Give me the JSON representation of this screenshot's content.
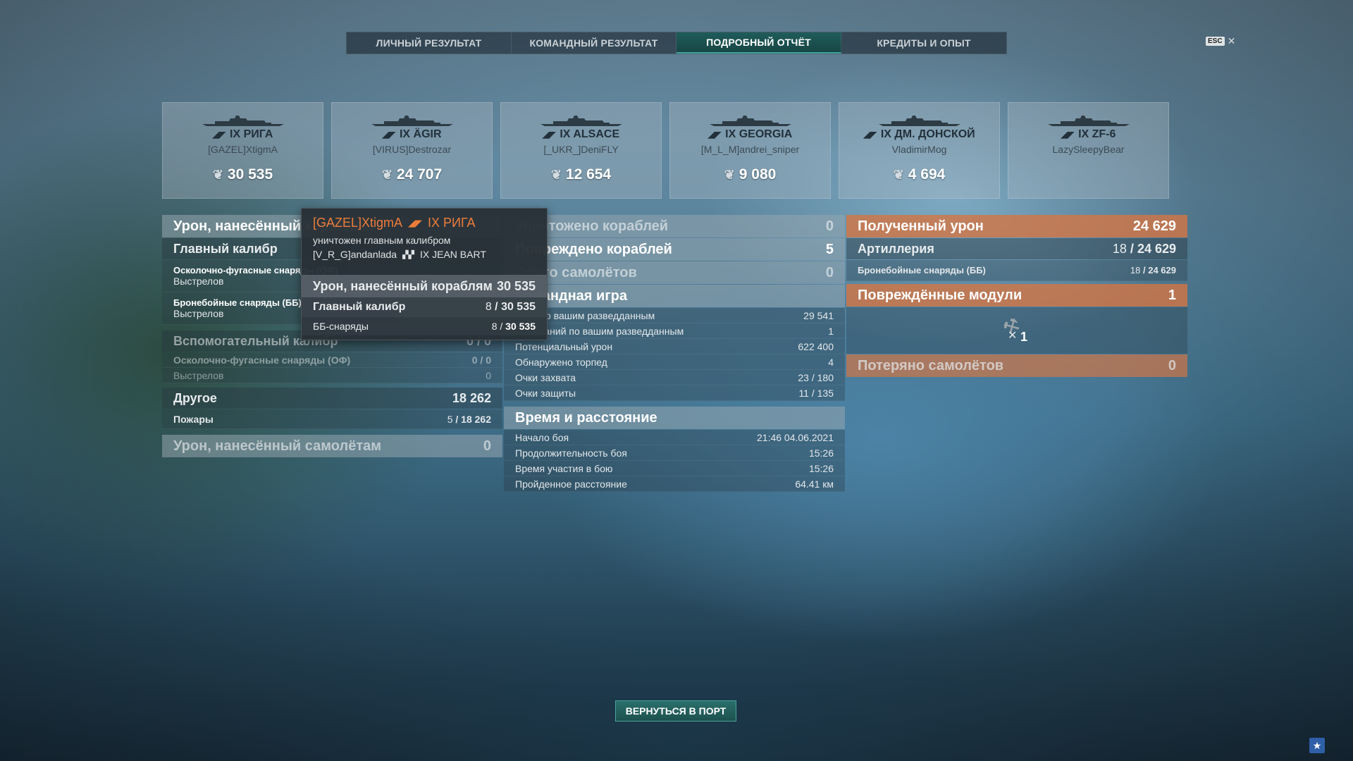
{
  "tabs": [
    {
      "label": "ЛИЧНЫЙ РЕЗУЛЬТАТ",
      "active": false
    },
    {
      "label": "КОМАНДНЫЙ РЕЗУЛЬТАТ",
      "active": false
    },
    {
      "label": "ПОДРОБНЫЙ ОТЧЁТ",
      "active": true
    },
    {
      "label": "КРЕДИТЫ И ОПЫТ",
      "active": false
    }
  ],
  "esc": {
    "key": "ESC",
    "close": "✕"
  },
  "ships": [
    {
      "name": "IX РИГА",
      "player": "[GAZEL]XtigmA",
      "damage": "30 535"
    },
    {
      "name": "IX ÄGIR",
      "player": "[VIRUS]Destrozar",
      "damage": "24 707"
    },
    {
      "name": "IX ALSACE",
      "player": "[_UKR_]DeniFLY",
      "damage": "12 654"
    },
    {
      "name": "IX GEORGIA",
      "player": "[M_L_M]andrei_sniper",
      "damage": "9 080"
    },
    {
      "name": "IX ДМ. ДОНСКОЙ",
      "player": "VladimirMog",
      "damage": "4 694"
    },
    {
      "name": "IX ZF-6",
      "player": "LazySleepyBear",
      "damage": ""
    }
  ],
  "left": {
    "damage_header": "Урон, нанесённый кораблям",
    "main_battery": {
      "label": "Главный калибр"
    },
    "he": {
      "label": "Осколочно-фугасные снаряды (ОФ)",
      "shots_label": "Выстрелов"
    },
    "ap": {
      "label": "Бронебойные снаряды (ББ)",
      "shots_label": "Выстрелов"
    },
    "secondary": {
      "label": "Вспомогательный калибр",
      "value": "0 / 0"
    },
    "secondary_he": {
      "label": "Осколочно-фугасные снаряды (ОФ)",
      "value": "0 / 0"
    },
    "secondary_shots": {
      "label": "Выстрелов",
      "value": "0"
    },
    "other": {
      "label": "Другое",
      "value": "18 262"
    },
    "fires": {
      "label": "Пожары",
      "hits": "5",
      "dmg": "18 262"
    },
    "aircraft_damage": {
      "label": "Урон, нанесённый самолётам",
      "value": "0"
    }
  },
  "mid": {
    "destroyed": {
      "label": "Уничтожено кораблей",
      "value": "0"
    },
    "damaged": {
      "label": "Повреждено кораблей",
      "value": "5"
    },
    "planes": {
      "label": "Сбито самолётов",
      "value": "0"
    },
    "team_header": "Командная игра",
    "team": [
      {
        "label": "Урон по вашим разведданным",
        "value": "29 541"
      },
      {
        "label": "Попаданий по вашим разведданным",
        "value": "1"
      },
      {
        "label": "Потенциальный урон",
        "value": "622 400"
      },
      {
        "label": "Обнаружено торпед",
        "value": "4"
      },
      {
        "label": "Очки захвата",
        "value": "23 / 180"
      },
      {
        "label": "Очки защиты",
        "value": "11 / 135"
      }
    ],
    "time_header": "Время и расстояние",
    "time": [
      {
        "label": "Начало боя",
        "value": "21:46  04.06.2021"
      },
      {
        "label": "Продолжительность боя",
        "value": "15:26"
      },
      {
        "label": "Время участия в бою",
        "value": "15:26"
      },
      {
        "label": "Пройденное расстояние",
        "value": "64.41 км"
      }
    ]
  },
  "right": {
    "received": {
      "label": "Полученный урон",
      "value": "24 629"
    },
    "artillery": {
      "label": "Артиллерия",
      "hits": "18",
      "dmg": "24 629"
    },
    "ap": {
      "label": "Бронебойные снаряды (ББ)",
      "hits": "18",
      "dmg": "24 629"
    },
    "modules": {
      "label": "Повреждённые модули",
      "value": "1",
      "icon_count": "1"
    },
    "planes_lost": {
      "label": "Потеряно самолётов",
      "value": "0"
    }
  },
  "tooltip": {
    "player": "[GAZEL]XtigmA",
    "ship": "IX РИГА",
    "destroyed_by": "уничтожен главным калибром",
    "killer_player": "[V_R_G]andanlada",
    "killer_ship": "IX JEAN BART",
    "dmg_label": "Урон, нанесённый кораблям",
    "dmg_value": "30 535",
    "main_label": "Главный калибр",
    "main_hits": "8",
    "main_dmg": "30 535",
    "ap_label": "ББ-снаряды",
    "ap_hits": "8",
    "ap_dmg": "30 535"
  },
  "return_button": "ВЕРНУТЬСЯ В ПОРТ",
  "colors": {
    "accent": "#2a6f6b",
    "orange": "#d47644",
    "tooltip_name": "#ee7d3a"
  }
}
